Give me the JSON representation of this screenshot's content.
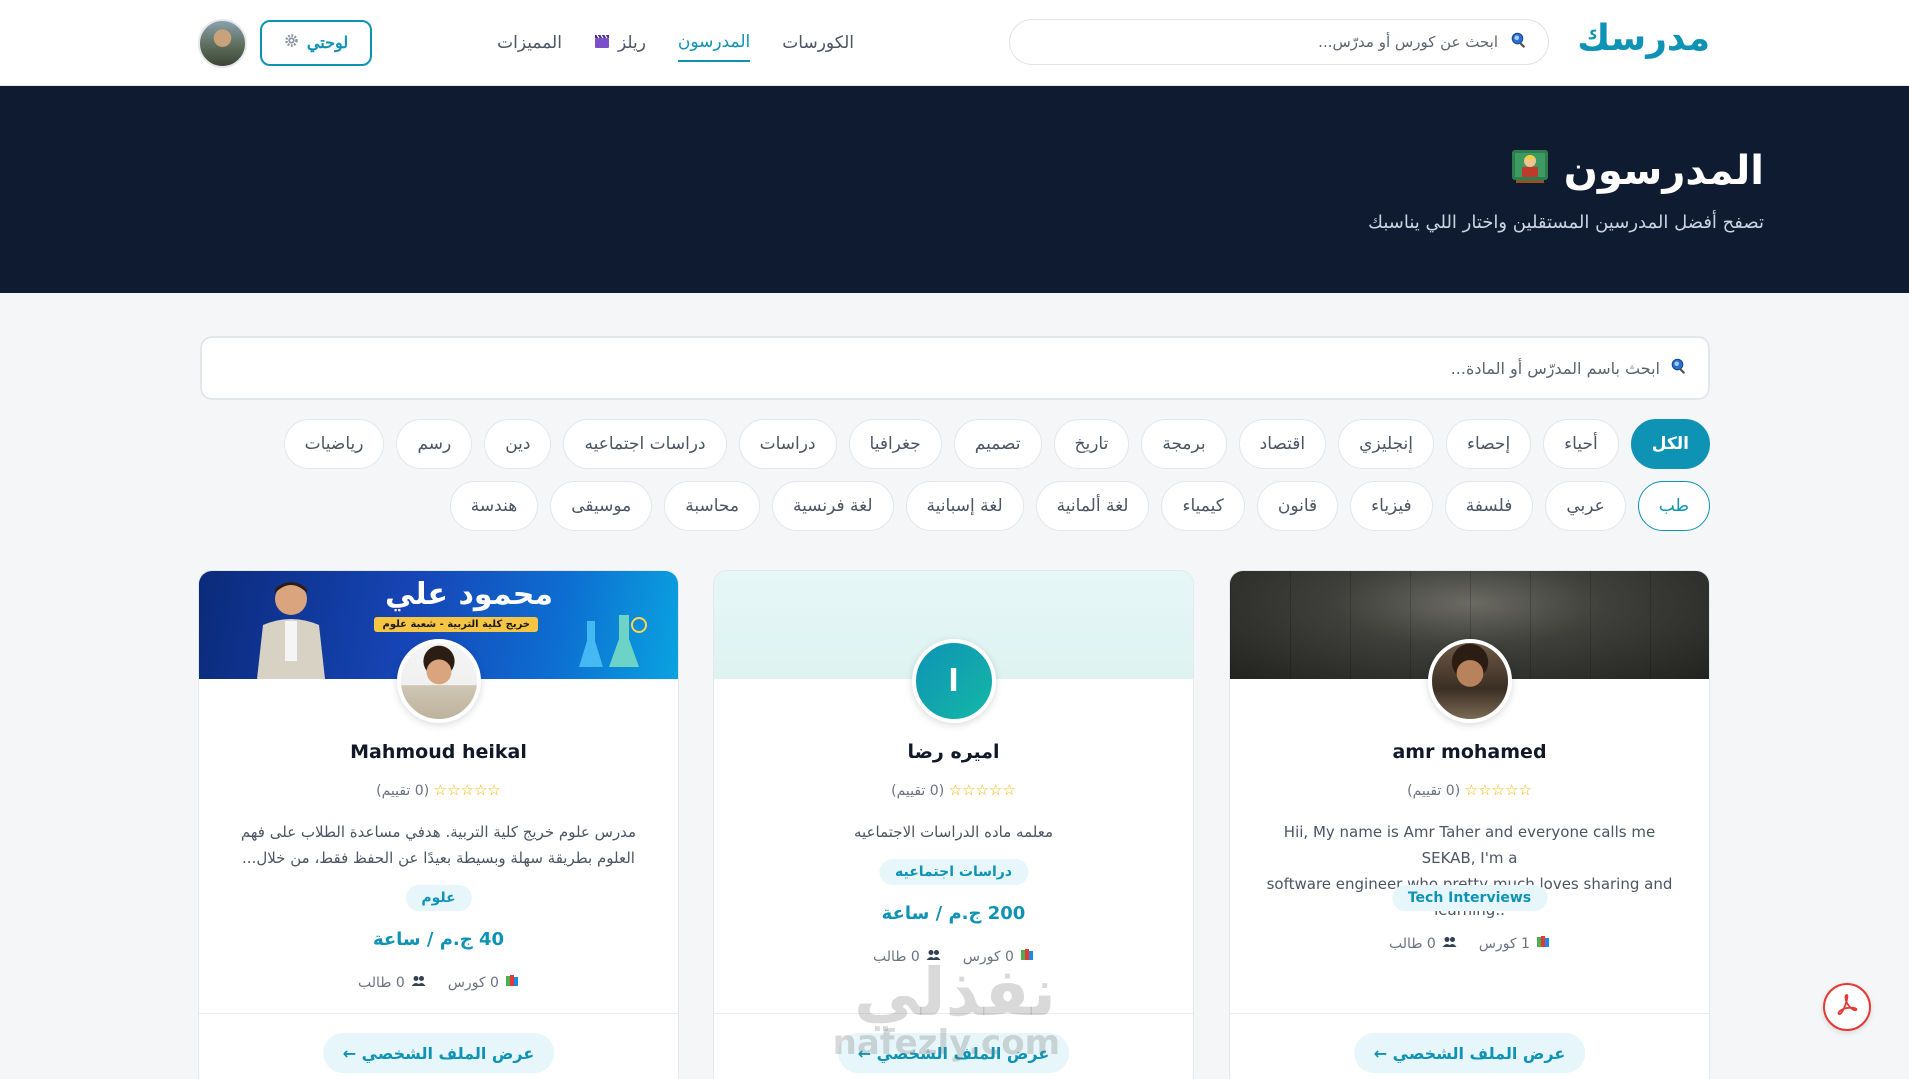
{
  "brand": {
    "name": "مدرسك"
  },
  "top_search": {
    "placeholder": "ابحث عن كورس أو مدرّس..."
  },
  "nav": {
    "links": [
      {
        "label": "الكورسات",
        "active": false
      },
      {
        "label": "المدرسون",
        "active": true
      },
      {
        "label": "ريلز",
        "active": false,
        "icon": "clapper-icon"
      },
      {
        "label": "المميزات",
        "active": false
      }
    ],
    "dashboard_label": "لوحتي"
  },
  "hero": {
    "title": "المدرسون",
    "subtitle": "تصفح أفضل المدرسين المستقلين واختار اللي يناسبك"
  },
  "filter": {
    "placeholder": "ابحث باسم المدرّس أو المادة...",
    "categories_row1": [
      "الكل",
      "أحياء",
      "إحصاء",
      "إنجليزي",
      "اقتصاد",
      "برمجة",
      "تاريخ",
      "تصميم",
      "جغرافيا",
      "دراسات",
      "دراسات اجتماعيه",
      "دين",
      "رسم",
      "رياضيات"
    ],
    "categories_row2": [
      "طب",
      "عربي",
      "فلسفة",
      "فيزياء",
      "قانون",
      "كيمياء",
      "لغة ألمانية",
      "لغة إسبانية",
      "لغة فرنسية",
      "محاسبة",
      "موسيقى",
      "هندسة"
    ],
    "active_category": "الكل"
  },
  "teachers": [
    {
      "name": "amr mohamed",
      "rating_text": "(0 تقييم)",
      "bio_line1": "Hii, My name is Amr Taher and everyone calls me SEKAB, I'm a",
      "bio_line2": "software engineer who pretty much loves sharing and learning..",
      "tag": "Tech Interviews",
      "price": "",
      "courses": "1 كورس",
      "students": "0 طالب",
      "button": "عرض الملف الشخصي ←"
    },
    {
      "name": "اميره رضا",
      "avatar_initial": "ا",
      "rating_text": "(0 تقييم)",
      "bio_line1": "معلمه ماده الدراسات الاجتماعيه",
      "bio_line2": "",
      "tag": "دراسات اجتماعيه",
      "price": "200 ج.م / ساعة",
      "courses": "0 كورس",
      "students": "0 طالب",
      "button": "عرض الملف الشخصي ←"
    },
    {
      "name": "Mahmoud heikal",
      "cover_title": "محمود علي",
      "cover_subtitle": "خريج كلية التربية - شعبة علوم",
      "rating_text": "(0 تقييم)",
      "bio_line1": "مدرس علوم خريج كلية التربية. هدفي مساعدة الطلاب على فهم",
      "bio_line2": "العلوم بطريقة سهلة وبسيطة بعيدًا عن الحفظ فقط، من خلال...",
      "tag": "علوم",
      "price": "40 ج.م / ساعة",
      "courses": "0 كورس",
      "students": "0 طالب",
      "button": "عرض الملف الشخصي ←"
    }
  ],
  "watermark": {
    "ar": "نفذلي",
    "en": "nafezly.com"
  },
  "colors": {
    "accent": "#0e93b5",
    "hero_bg": "#0f1b30",
    "star": "#f5b301"
  }
}
